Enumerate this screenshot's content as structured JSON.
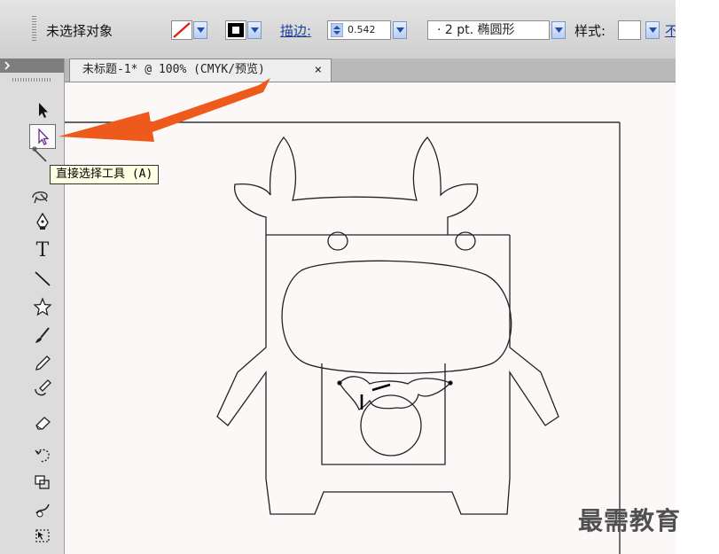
{
  "control_bar": {
    "selection_label": "未选择对象",
    "stroke_label": "描边:",
    "stroke_weight": "0.542",
    "brush_value": "· 2 pt. 椭圆形",
    "style_label": "样式:",
    "accent_color": "#e63b1d"
  },
  "document_tab": {
    "title": "未标题-1* @ 100% (CMYK/预览)",
    "close": "×"
  },
  "tools_panel": {
    "tools": [
      {
        "name": "selection-tool",
        "icon": "black-arrow-icon"
      },
      {
        "name": "direct-selection-tool",
        "icon": "white-arrow-icon"
      },
      {
        "name": "magic-wand-tool",
        "icon": "magic-wand-icon"
      },
      {
        "name": "lasso-tool",
        "icon": "lasso-icon"
      },
      {
        "name": "pen-tool",
        "icon": "pen-icon"
      },
      {
        "name": "type-tool",
        "icon": "type-icon",
        "glyph": "T"
      },
      {
        "name": "line-tool",
        "icon": "line-icon"
      },
      {
        "name": "star-tool",
        "icon": "star-icon"
      },
      {
        "name": "paintbrush-tool",
        "icon": "brush-icon"
      },
      {
        "name": "pencil-tool",
        "icon": "pencil-icon"
      },
      {
        "name": "blob-brush-tool",
        "icon": "blob-brush-icon"
      },
      {
        "name": "eraser-tool",
        "icon": "eraser-icon"
      },
      {
        "name": "rotate-tool",
        "icon": "rotate-icon"
      },
      {
        "name": "scale-tool",
        "icon": "scale-icon"
      },
      {
        "name": "warp-tool",
        "icon": "warp-icon"
      },
      {
        "name": "free-transform-tool",
        "icon": "free-transform-icon"
      }
    ]
  },
  "tooltip": {
    "text": "直接选择工具 (A)"
  },
  "watermark": {
    "text": "最需教育"
  }
}
